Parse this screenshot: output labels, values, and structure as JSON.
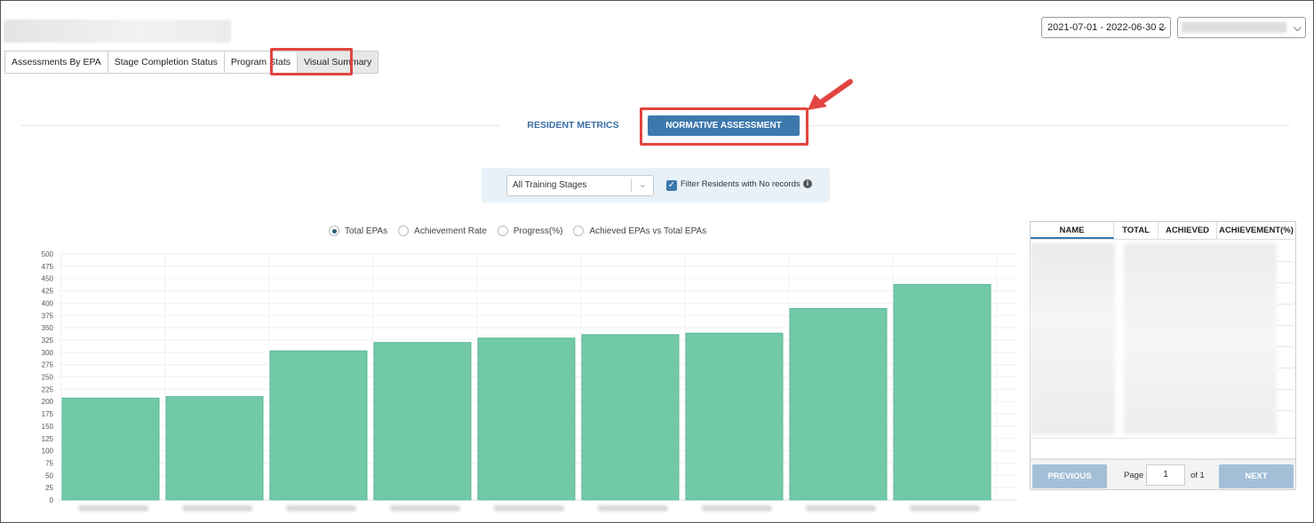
{
  "header": {
    "date_range": "2021-07-01 - 2022-06-30 2",
    "dropdown_chevron": "chevron-down-icon"
  },
  "tabs": [
    {
      "label": "Assessments By EPA"
    },
    {
      "label": "Stage Completion Status"
    },
    {
      "label": "Program Stats"
    },
    {
      "label": "Visual Summary",
      "active": true
    }
  ],
  "subnav": {
    "resident_metrics": "RESIDENT METRICS",
    "normative_assessment": "NORMATIVE ASSESSMENT"
  },
  "filter": {
    "stage_value": "All Training Stages",
    "checkbox_checked": true,
    "checkbox_label": "Filter Residents with No records",
    "info_icon": "info-icon"
  },
  "chart_options": [
    {
      "label": "Total EPAs",
      "selected": true
    },
    {
      "label": "Achievement Rate",
      "selected": false
    },
    {
      "label": "Progress(%)",
      "selected": false
    },
    {
      "label": "Achieved EPAs vs Total EPAs",
      "selected": false
    }
  ],
  "chart_data": {
    "type": "bar",
    "title": "",
    "xlabel": "",
    "ylabel": "",
    "ylim": [
      0,
      500
    ],
    "yticks": [
      0,
      25,
      50,
      75,
      100,
      125,
      150,
      175,
      200,
      225,
      250,
      275,
      300,
      325,
      350,
      375,
      400,
      425,
      450,
      475,
      500
    ],
    "values": [
      207,
      210,
      303,
      320,
      329,
      336,
      339,
      389,
      438
    ],
    "bar_color": "#72c9a8",
    "bar_edge_color": "#5bb893",
    "grid": true
  },
  "table": {
    "headers": [
      "NAME",
      "TOTAL",
      "ACHIEVED",
      "ACHIEVEMENT(%)"
    ],
    "active_header": "NAME"
  },
  "pagination": {
    "previous": "PREVIOUS",
    "page_label": "Page",
    "page_value": "1",
    "of_label": "of 1",
    "next": "NEXT"
  },
  "colors": {
    "accent": "#3d78ad",
    "highlight": "#e2443f",
    "filter_bg": "#e8f1f8"
  }
}
